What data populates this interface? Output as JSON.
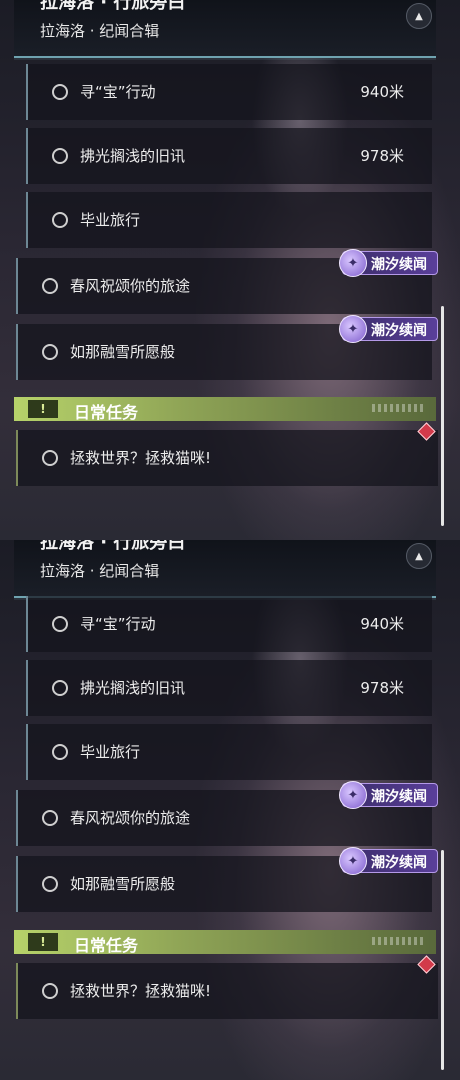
{
  "header": {
    "title": "拉海洛 · 行旅旁白",
    "subtitle": "拉海洛 · 纪闻合辑"
  },
  "quests": [
    {
      "name": "寻“宝”行动",
      "distance": "940米"
    },
    {
      "name": "拂光搁浅的旧讯",
      "distance": "978米"
    },
    {
      "name": "毕业旅行"
    },
    {
      "name": "春风祝颂你的旅途"
    },
    {
      "name": "如那融雪所愿般"
    }
  ],
  "event_badge": {
    "label": "潮汐续闻",
    "icon": "feather-sparkle-icon"
  },
  "daily_section": {
    "label": "日常任务",
    "icon": "exclamation-icon",
    "quest": {
      "name": "拯救世界？拯救猫咪!"
    }
  },
  "collapse_icon": "chevron-up-icon",
  "colors": {
    "accent_teal": "#6fa3b0",
    "daily_green": "#b7d36a",
    "event_purple": "#5a3f9a",
    "alert_red": "#d23a4a"
  }
}
